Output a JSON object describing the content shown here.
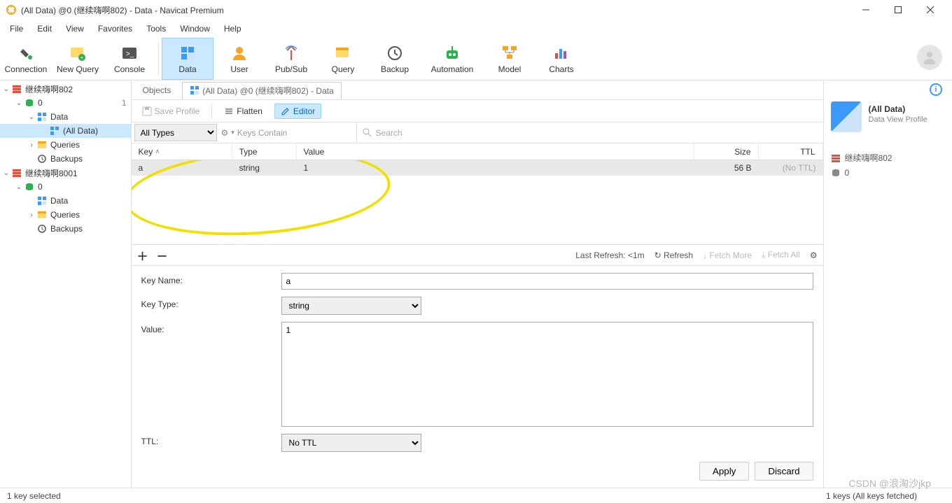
{
  "window": {
    "title": "(All Data) @0 (继续嗨啊802) - Data - Navicat Premium"
  },
  "menu": {
    "items": [
      "File",
      "Edit",
      "View",
      "Favorites",
      "Tools",
      "Window",
      "Help"
    ]
  },
  "toolbar": {
    "items": [
      {
        "label": "Connection"
      },
      {
        "label": "New Query"
      },
      {
        "label": "Console"
      },
      {
        "label": "Data",
        "active": true
      },
      {
        "label": "User"
      },
      {
        "label": "Pub/Sub"
      },
      {
        "label": "Query"
      },
      {
        "label": "Backup"
      },
      {
        "label": "Automation"
      },
      {
        "label": "Model"
      },
      {
        "label": "Charts"
      }
    ]
  },
  "tree": {
    "nodes": [
      {
        "level": 0,
        "expand": "v",
        "icon": "redis",
        "label": "继续嗨啊802"
      },
      {
        "level": 1,
        "expand": "v",
        "icon": "db-green",
        "label": "0",
        "badge": "1"
      },
      {
        "level": 2,
        "expand": "v",
        "icon": "data",
        "label": "Data"
      },
      {
        "level": 3,
        "expand": "",
        "icon": "data",
        "label": "(All Data)",
        "selected": true
      },
      {
        "level": 2,
        "expand": ">",
        "icon": "query",
        "label": "Queries"
      },
      {
        "level": 2,
        "expand": "",
        "icon": "backup",
        "label": "Backups"
      },
      {
        "level": 0,
        "expand": "v",
        "icon": "redis",
        "label": "继续嗨啊8001"
      },
      {
        "level": 1,
        "expand": "v",
        "icon": "db-green",
        "label": "0"
      },
      {
        "level": 2,
        "expand": "",
        "icon": "data",
        "label": "Data"
      },
      {
        "level": 2,
        "expand": ">",
        "icon": "query",
        "label": "Queries"
      },
      {
        "level": 2,
        "expand": "",
        "icon": "backup",
        "label": "Backups"
      }
    ]
  },
  "tabs": {
    "objects": "Objects",
    "active": "(All Data) @0 (继续嗨啊802) - Data"
  },
  "subbar": {
    "save": "Save Profile",
    "flatten": "Flatten",
    "editor": "Editor"
  },
  "filter": {
    "types": "All Types",
    "kc": "Keys Contain",
    "search": "Search"
  },
  "grid": {
    "headers": {
      "key": "Key",
      "type": "Type",
      "value": "Value",
      "size": "Size",
      "ttl": "TTL"
    },
    "rows": [
      {
        "key": "a",
        "type": "string",
        "value": "1",
        "size": "56 B",
        "ttl": "(No TTL)"
      }
    ]
  },
  "listfoot": {
    "refreshinfo": "Last Refresh: <1m",
    "refresh": "Refresh",
    "more": "Fetch More",
    "all": "Fetch All"
  },
  "editor": {
    "keyname_l": "Key Name:",
    "keyname": "a",
    "keytype_l": "Key Type:",
    "keytype": "string",
    "value_l": "Value:",
    "value": "1",
    "ttl_l": "TTL:",
    "ttl": "No TTL",
    "apply": "Apply",
    "discard": "Discard"
  },
  "rpanel": {
    "title": "(All Data)",
    "sub": "Data View Profile",
    "conn": "继续嗨啊802",
    "db": "0"
  },
  "status": {
    "left": "1 key selected",
    "right": "1 keys (All keys fetched)"
  },
  "watermark": "CSDN @浪淘沙jkp"
}
